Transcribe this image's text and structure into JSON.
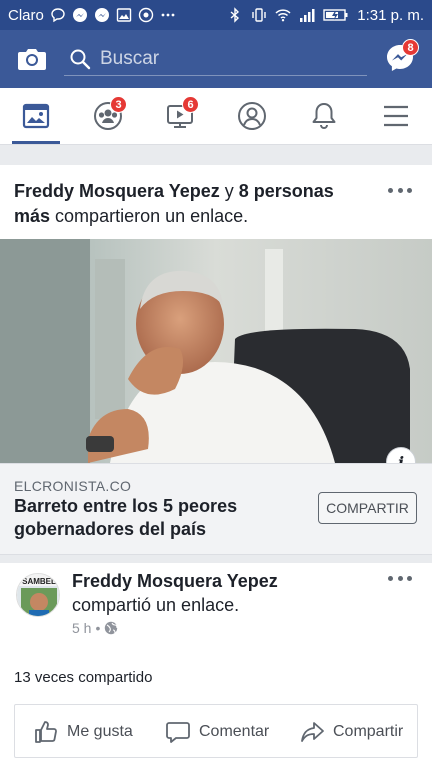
{
  "status_bar": {
    "carrier": "Claro",
    "time": "1:31 p. m.",
    "icons": [
      "chat-bubble-icon",
      "messenger-icon",
      "messenger-icon",
      "image-icon",
      "chrome-icon",
      "more-icon",
      "bluetooth-icon",
      "vibrate-icon",
      "wifi-icon",
      "signal-icon",
      "battery-charging-icon"
    ]
  },
  "header": {
    "search_placeholder": "Buscar",
    "messenger_badge": "8",
    "brand_color": "#3b5998"
  },
  "tabs": [
    {
      "name": "news-feed-icon",
      "badge": ""
    },
    {
      "name": "groups-icon",
      "badge": "3"
    },
    {
      "name": "watch-icon",
      "badge": "6"
    },
    {
      "name": "profile-icon",
      "badge": ""
    },
    {
      "name": "notifications-icon",
      "badge": ""
    },
    {
      "name": "menu-icon",
      "badge": ""
    }
  ],
  "post1": {
    "author": "Freddy Mosquera Yepez",
    "connector": "y",
    "others": "8 personas más",
    "action": "compartieron un enlace.",
    "link": {
      "domain": "ELCRONISTA.CO",
      "title": "Barreto entre los 5 peores gobernadores del país",
      "share_button": "COMPARTIR"
    }
  },
  "post2": {
    "author": "Freddy Mosquera Yepez",
    "action": "compartió un enlace.",
    "time": "5 h",
    "separator": "•",
    "share_count": "13 veces compartido",
    "buttons": {
      "like": "Me gusta",
      "comment": "Comentar",
      "share": "Compartir"
    }
  }
}
